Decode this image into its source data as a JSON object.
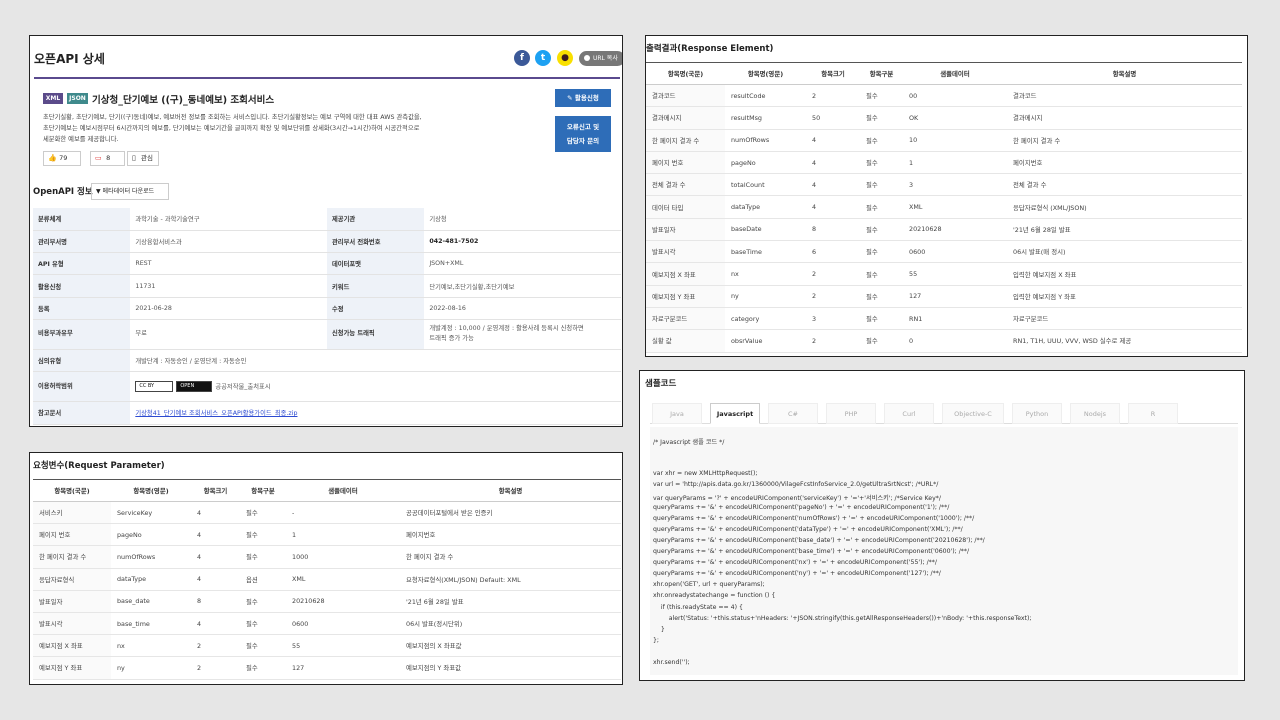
{
  "detail": {
    "title": "오픈API 상세",
    "share_url_label": "URL 복사",
    "share_icons": [
      "facebook-icon",
      "twitter-icon",
      "kakao-icon"
    ],
    "tag_xml": "XML",
    "tag_json": "JSON",
    "service_title": "기상청_단기예보 ((구)_동네예보) 조회서비스",
    "description_lines": [
      "초단기실황, 초단기예보, 단기((구)동네)예보, 예보버전 정보를 조회하는 서비스입니다. 초단기실황정보는 예보 구역에 대한 대표 AWS 관측값을,",
      "초단기예보는 예보시점부터 6시간까지의 예보를, 단기예보는 예보기간을 글피까지 확장 및 예보단위를 상세화(3시간→1시간)하여 시공간적으로",
      "세분화한 예보를 제공합니다."
    ],
    "apply_button": "활용신청",
    "report_button_lines": [
      "오류신고 및",
      "담당자 문의"
    ],
    "like_count": "79",
    "comment_count": "8",
    "interest_label": "관심",
    "openapi_label": "OpenAPI 정보",
    "metadata_button": "메타데이터 다운로드",
    "info": {
      "category_k": "분류체계",
      "category_v": "과학기술 - 과학기술연구",
      "provider_k": "제공기관",
      "provider_v": "기상청",
      "dept_k": "관리부서명",
      "dept_v": "기상융합서비스과",
      "phone_k": "관리부서 전화번호",
      "phone_v": "042-481-7502",
      "apitype_k": "API 유형",
      "apitype_v": "REST",
      "format_k": "데이터포맷",
      "format_v": "JSON+XML",
      "usage_k": "활용신청",
      "usage_v": "11731",
      "keyword_k": "키워드",
      "keyword_v": "단기예보,초단기실황,초단기예보",
      "reg_k": "등록",
      "reg_v": "2021-06-28",
      "mod_k": "수정",
      "mod_v": "2022-08-16",
      "fee_k": "비용부과유무",
      "fee_v": "무료",
      "traffic_k": "신청가능 트래픽",
      "traffic_v1": "개발계정 : 10,000 / 운영계정 : 활용사례 등록시 신청하면",
      "traffic_v2": "트래픽 증가 가능",
      "review_k": "심의유형",
      "review_v": "개발단계 : 자동승인 / 운영단계 : 자동승인",
      "license_k": "이용허락범위",
      "license_cc": "CC BY",
      "license_open": "OPEN",
      "license_v": "공공저작물_출처표시",
      "ref_k": "참고문서",
      "ref_v": "기상청41_단기예보 조회서비스_오픈API활용가이드_최종.zip"
    }
  },
  "request_params": {
    "title": "요청변수(Request Parameter)",
    "headers": [
      "항목명(국문)",
      "항목명(영문)",
      "항목크기",
      "항목구분",
      "샘플데이터",
      "항목설명"
    ],
    "rows": [
      [
        "서비스키",
        "ServiceKey",
        "4",
        "필수",
        "-",
        "공공데이터포털에서 받은 인증키"
      ],
      [
        "페이지 번호",
        "pageNo",
        "4",
        "필수",
        "1",
        "페이지번호"
      ],
      [
        "한 페이지 결과 수",
        "numOfRows",
        "4",
        "필수",
        "1000",
        "한 페이지 결과 수"
      ],
      [
        "응답자료형식",
        "dataType",
        "4",
        "옵션",
        "XML",
        "요청자료형식(XML/JSON) Default: XML"
      ],
      [
        "발표일자",
        "base_date",
        "8",
        "필수",
        "20210628",
        "'21년 6월 28일 발표"
      ],
      [
        "발표시각",
        "base_time",
        "4",
        "필수",
        "0600",
        "06시 발표(정시단위)"
      ],
      [
        "예보지점 X 좌표",
        "nx",
        "2",
        "필수",
        "55",
        "예보지점의 X 좌표값"
      ],
      [
        "예보지점 Y 좌표",
        "ny",
        "2",
        "필수",
        "127",
        "예보지점의 Y 좌표값"
      ]
    ]
  },
  "response_elements": {
    "title": "출력결과(Response Element)",
    "headers": [
      "항목명(국문)",
      "항목명(영문)",
      "항목크기",
      "항목구분",
      "샘플데이터",
      "항목설명"
    ],
    "rows": [
      [
        "결과코드",
        "resultCode",
        "2",
        "필수",
        "00",
        "결과코드"
      ],
      [
        "결과메시지",
        "resultMsg",
        "50",
        "필수",
        "OK",
        "결과메시지"
      ],
      [
        "한 페이지 결과 수",
        "numOfRows",
        "4",
        "필수",
        "10",
        "한 페이지 결과 수"
      ],
      [
        "페이지 번호",
        "pageNo",
        "4",
        "필수",
        "1",
        "페이지번호"
      ],
      [
        "전체 결과 수",
        "totalCount",
        "4",
        "필수",
        "3",
        "전체 결과 수"
      ],
      [
        "데이터 타입",
        "dataType",
        "4",
        "필수",
        "XML",
        "응답자료형식 (XML/JSON)"
      ],
      [
        "발표일자",
        "baseDate",
        "8",
        "필수",
        "20210628",
        "'21년 6월 28일 발표"
      ],
      [
        "발표시각",
        "baseTime",
        "6",
        "필수",
        "0600",
        "06시 발표(매 정시)"
      ],
      [
        "예보지점 X 좌표",
        "nx",
        "2",
        "필수",
        "55",
        "입력한 예보지점 X 좌표"
      ],
      [
        "예보지점 Y 좌표",
        "ny",
        "2",
        "필수",
        "127",
        "입력한 예보지점 Y 좌표"
      ],
      [
        "자료구분코드",
        "category",
        "3",
        "필수",
        "RN1",
        "자료구분코드"
      ],
      [
        "실황 값",
        "obsrValue",
        "2",
        "필수",
        "0",
        "RN1, T1H, UUU, VVV, WSD 실수로 제공"
      ]
    ]
  },
  "sample_code": {
    "title": "샘플코드",
    "tabs": [
      "Java",
      "Javascript",
      "C#",
      "PHP",
      "Curl",
      "Objective-C",
      "Python",
      "Nodejs",
      "R"
    ],
    "active_tab": "Javascript",
    "lines": [
      "/* Javascript 샘플 코드 */",
      "",
      "",
      "var xhr = new XMLHttpRequest();",
      "var url = 'http://apis.data.go.kr/1360000/VilageFcstInfoService_2.0/getUltraSrtNcst'; /*URL*/",
      "var queryParams = '?' + encodeURIComponent('serviceKey') + '='+'서비스키'; /*Service Key*/",
      "queryParams += '&' + encodeURIComponent('pageNo') + '=' + encodeURIComponent('1'); /**/",
      "queryParams += '&' + encodeURIComponent('numOfRows') + '=' + encodeURIComponent('1000'); /**/",
      "queryParams += '&' + encodeURIComponent('dataType') + '=' + encodeURIComponent('XML'); /**/",
      "queryParams += '&' + encodeURIComponent('base_date') + '=' + encodeURIComponent('20210628'); /**/",
      "queryParams += '&' + encodeURIComponent('base_time') + '=' + encodeURIComponent('0600'); /**/",
      "queryParams += '&' + encodeURIComponent('nx') + '=' + encodeURIComponent('55'); /**/",
      "queryParams += '&' + encodeURIComponent('ny') + '=' + encodeURIComponent('127'); /**/",
      "xhr.open('GET', url + queryParams);",
      "xhr.onreadystatechange = function () {",
      "    if (this.readyState == 4) {",
      "        alert('Status: '+this.status+'nHeaders: '+JSON.stringify(this.getAllResponseHeaders())+'nBody: '+this.responseText);",
      "    }",
      "};",
      "",
      "xhr.send('');"
    ]
  }
}
